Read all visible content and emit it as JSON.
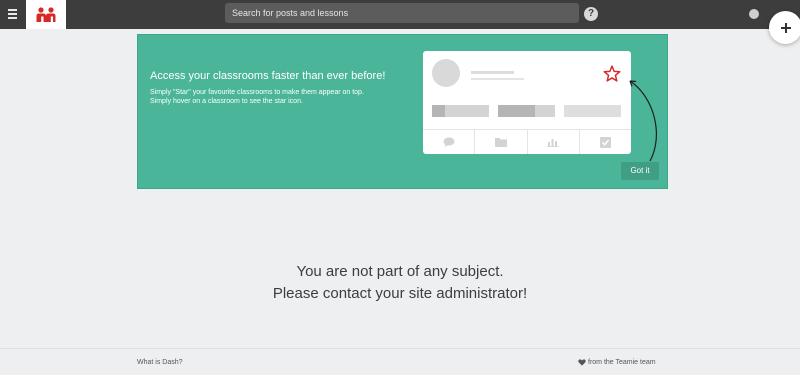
{
  "topbar": {
    "search_placeholder": "Search for posts and lessons",
    "help_label": "?"
  },
  "banner": {
    "title": "Access your classrooms faster than ever before!",
    "line1": "Simply \"Star\" your favourite classrooms to make them appear on top.",
    "line2": "Simply hover on a classroom to see the star icon.",
    "got_it_label": "Got it"
  },
  "main": {
    "message_line1": "You are not part of any subject.",
    "message_line2": "Please contact your site administrator!"
  },
  "footer": {
    "left_link": "What is Dash?",
    "right_text": "from the Teamie team"
  },
  "colors": {
    "topbar": "#3d3d3d",
    "banner": "#4ab598",
    "logo_red": "#d62a2a",
    "star_red": "#d62a2a"
  },
  "icons": [
    "menu-icon",
    "teamie-logo",
    "help-icon",
    "globe-icon",
    "plus-icon",
    "star-icon",
    "comment-icon",
    "folder-icon",
    "chart-icon",
    "checkbox-icon",
    "heart-icon"
  ]
}
